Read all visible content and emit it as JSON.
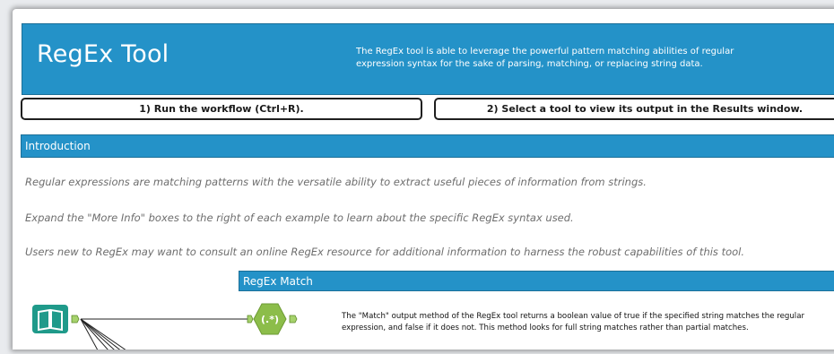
{
  "header": {
    "title": "RegEx Tool",
    "description": "The RegEx tool is able to leverage the powerful pattern matching abilities of regular expression syntax for the sake of parsing, matching, or replacing string data.",
    "color": "#2492c8"
  },
  "steps": [
    {
      "label": "1) Run the workflow (Ctrl+R)."
    },
    {
      "label": "2) Select a tool to view its output in the Results window."
    }
  ],
  "introduction": {
    "title": "Introduction",
    "paragraphs": [
      "Regular expressions are matching patterns with the versatile ability to extract useful pieces of information from strings.",
      "Expand the \"More Info\" boxes to the right of each example to learn about the specific RegEx syntax used.",
      "Users new to RegEx may want to consult an online RegEx resource for additional information to harness the robust capabilities of this tool."
    ]
  },
  "regex_match": {
    "title": "RegEx Match",
    "description": "The \"Match\" output method of the RegEx tool returns a boolean value of true if the specified string matches the regular expression, and false if it does not. This method looks for full string matches rather than partial matches."
  },
  "workflow": {
    "input_icon": "book-icon",
    "input_color": "#1f9a8a",
    "regex_icon": "regex-hexagon-icon",
    "regex_glyph": "(.*)",
    "regex_color": "#8cbd4a"
  }
}
